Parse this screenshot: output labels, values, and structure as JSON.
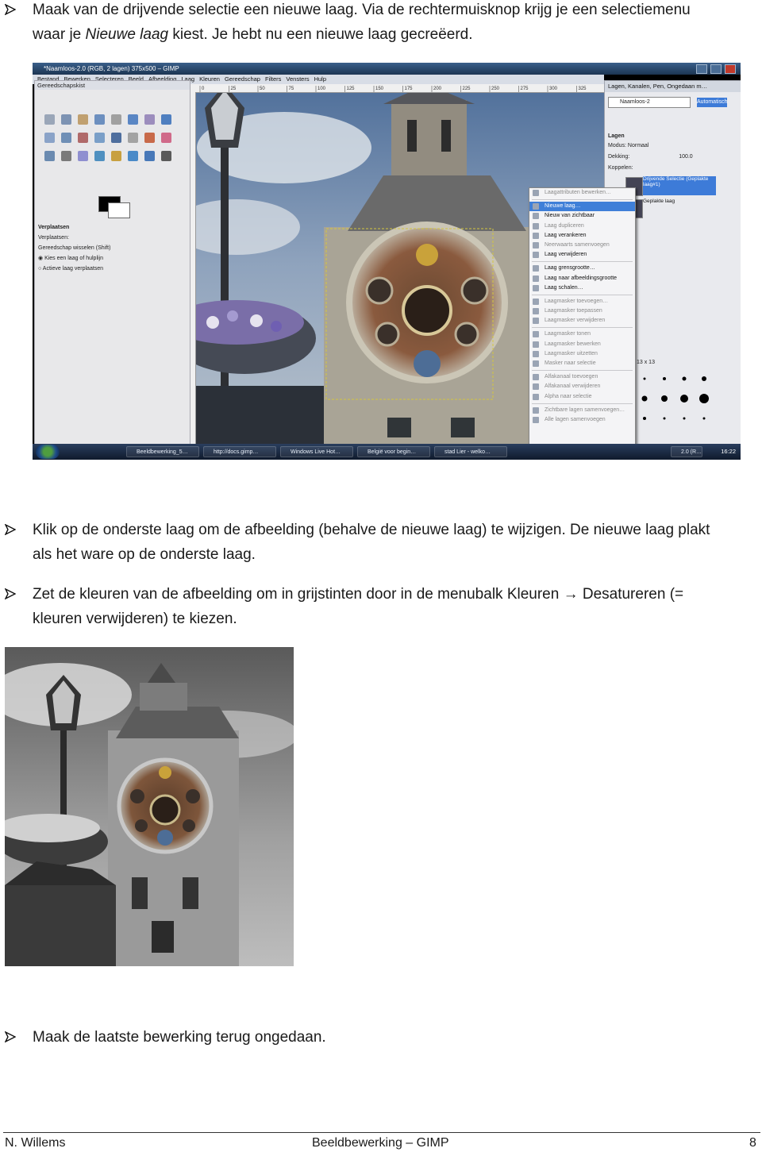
{
  "bullets": [
    {
      "line1": "Maak van de drijvende selectie een nieuwe laag. Via de rechtermuisknop krijg je een selectiemenu",
      "line2_pre": "waar je ",
      "line2_em": "Nieuwe laag",
      "line2_post": " kiest. Je hebt nu een nieuwe laag gecreëerd."
    },
    {
      "line1": "Klik op de onderste laag om de afbeelding (behalve de nieuwe laag) te wijzigen. De nieuwe laag plakt",
      "line2": "als het ware op de onderste laag."
    },
    {
      "line1": "Zet de kleuren van de afbeelding om in grijstinten door in de menubalk Kleuren → Desatureren (=",
      "line2": "kleuren verwijderen) te kiezen."
    },
    {
      "line1": "Maak de laatste bewerking terug ongedaan."
    }
  ],
  "screenshot": {
    "window_title": "*Naamloos-2.0 (RGB, 2 lagen) 375x500 – GIMP",
    "menubar": [
      "Bestand",
      "Bewerken",
      "Selecteren",
      "Beeld",
      "Afbeelding",
      "Laag",
      "Kleuren",
      "Gereedschap",
      "Filters",
      "Vensters",
      "Hulp"
    ],
    "toolbox": {
      "title": "Gereedschapskist",
      "options_title": "Verplaatsen",
      "move_label": "Verplaatsen:",
      "switch_label": "Gereedschap wisselen (Shift)",
      "option1": "Kies een laag of hulplijn",
      "option2": "Actieve laag verplaatsen"
    },
    "layers_panel": {
      "title": "Lagen, Kanalen, Pen, Ongedaan m…",
      "image_select": "Naamloos-2",
      "auto_button": "Automatisch",
      "section": "Lagen",
      "mode_label": "Modus:",
      "mode_value": "Normaal",
      "opacity_label": "Dekking:",
      "opacity_value": "100.0",
      "lock_label": "Koppelen:",
      "layer1": "Drijvende Selectie (Geplakte laag#1)",
      "layer2": "Geplakte laag",
      "brush_label": "13 x 13"
    },
    "context_menu": [
      {
        "label": "Laagattributen bewerken…",
        "state": "dim"
      },
      {
        "sep": true
      },
      {
        "label": "Nieuwe laag…",
        "state": "hl"
      },
      {
        "label": "Nieuw van zichtbaar",
        "state": ""
      },
      {
        "label": "Laag dupliceren",
        "state": "dim"
      },
      {
        "label": "Laag verankeren",
        "state": ""
      },
      {
        "label": "Neerwaarts samenvoegen",
        "state": "dim"
      },
      {
        "label": "Laag verwijderen",
        "state": ""
      },
      {
        "sep": true
      },
      {
        "label": "Laag grensgrootte…",
        "state": ""
      },
      {
        "label": "Laag naar afbeeldingsgrootte",
        "state": ""
      },
      {
        "label": "Laag schalen…",
        "state": ""
      },
      {
        "sep": true
      },
      {
        "label": "Laagmasker toevoegen…",
        "state": "dim"
      },
      {
        "label": "Laagmasker toepassen",
        "state": "dim"
      },
      {
        "label": "Laagmasker verwijderen",
        "state": "dim"
      },
      {
        "sep": true
      },
      {
        "label": "Laagmasker tonen",
        "state": "dim"
      },
      {
        "label": "Laagmasker bewerken",
        "state": "dim"
      },
      {
        "label": "Laagmasker uitzetten",
        "state": "dim"
      },
      {
        "label": "Masker naar selectie",
        "state": "dim"
      },
      {
        "sep": true
      },
      {
        "label": "Alfakanaal toevoegen",
        "state": "dim"
      },
      {
        "label": "Alfakanaal verwijderen",
        "state": "dim"
      },
      {
        "label": "Alpha naar selectie",
        "state": "dim"
      },
      {
        "sep": true
      },
      {
        "label": "Zichtbare lagen samenvoegen…",
        "state": "dim"
      },
      {
        "label": "Alle lagen samenvoegen",
        "state": "dim"
      }
    ],
    "taskbar": [
      {
        "label": "Beeldbewerking_5…"
      },
      {
        "label": "http://docs.gimp…"
      },
      {
        "label": "Windows Live Hot…"
      },
      {
        "label": "België voor begin…"
      },
      {
        "label": "stad Lier - welko…"
      }
    ],
    "taskbar_right": "2.0 (R…",
    "clock": "16:22",
    "ruler_marks": [
      "0",
      "25",
      "50",
      "75",
      "100",
      "125",
      "150",
      "175",
      "200",
      "225",
      "250",
      "275",
      "300",
      "325"
    ]
  },
  "footer": {
    "left": "N. Willems",
    "center": "Beeldbewerking – GIMP",
    "right": "8"
  }
}
